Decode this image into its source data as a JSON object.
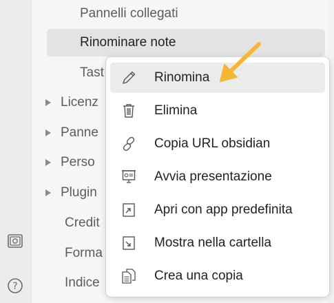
{
  "ribbon": {
    "icons": [
      "vault-icon",
      "help-icon"
    ]
  },
  "sidebar": {
    "items": [
      {
        "label": "Pannelli collegati",
        "expandable": false,
        "active": false
      },
      {
        "label": "Rinominare note",
        "expandable": false,
        "active": true
      },
      {
        "label": "Tast",
        "expandable": false,
        "active": false
      },
      {
        "label": "Licenz",
        "expandable": true,
        "active": false
      },
      {
        "label": "Panne",
        "expandable": true,
        "active": false
      },
      {
        "label": "Perso",
        "expandable": true,
        "active": false
      },
      {
        "label": "Plugin",
        "expandable": true,
        "active": false
      },
      {
        "label": "Credit",
        "expandable": false,
        "active": false
      },
      {
        "label": "Forma",
        "expandable": false,
        "active": false
      },
      {
        "label": "Indice",
        "expandable": false,
        "active": false
      }
    ]
  },
  "context_menu": {
    "items": [
      {
        "label": "Rinomina",
        "icon": "pencil-icon"
      },
      {
        "label": "Elimina",
        "icon": "trash-icon"
      },
      {
        "label": "Copia URL obsidian",
        "icon": "link-icon"
      },
      {
        "label": "Avvia presentazione",
        "icon": "presentation-icon"
      },
      {
        "label": "Apri con app predefinita",
        "icon": "open-external-icon"
      },
      {
        "label": "Mostra nella cartella",
        "icon": "show-in-folder-icon"
      },
      {
        "label": "Crea una copia",
        "icon": "copy-icon"
      }
    ]
  },
  "colors": {
    "arrow": "#f5b731",
    "hover": "#ebebeb",
    "active_item": "#e3e3e3"
  }
}
